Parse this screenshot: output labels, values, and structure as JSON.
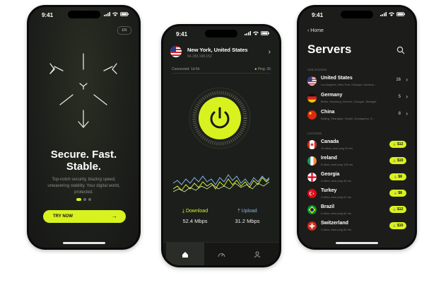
{
  "onboarding": {
    "status_time": "9:41",
    "lang": "EN",
    "headline": [
      "Secure. Fast.",
      "Stable."
    ],
    "description": [
      "Top-notch security, blazing speed,",
      "unwavering stability. Your digital world,",
      "protected."
    ],
    "cta_label": "TRY NOW",
    "cta_arrow": "→"
  },
  "connection": {
    "status_time": "9:41",
    "location_name": "New York, United States",
    "ip": "64.183.168.152",
    "connected_label": "Connected: 1d 6h",
    "ping_label": "Ping:",
    "ping_value": "26",
    "download_label": "Download",
    "download_value": "52.4 Mbps",
    "upload_label": "Upload",
    "upload_value": "31.2 Mbps",
    "tabs": [
      {
        "icon": "home-icon",
        "active": true
      },
      {
        "icon": "speedometer-icon",
        "active": false
      },
      {
        "icon": "profile-icon",
        "active": false
      }
    ]
  },
  "servers": {
    "status_time": "9:41",
    "back_label": "Home",
    "title": "Servers",
    "unlocked_label": "UNLOCKED",
    "locked_label": "LOCKED",
    "unlocked": [
      {
        "name": "United States",
        "cities": "Los Angeles, New York, Chicago, Houston...",
        "count": "16",
        "flag": "us"
      },
      {
        "name": "Germany",
        "cities": "Berlin, Hamburg, Munich, Cologne, Stuttgart",
        "count": "5",
        "flag": "de"
      },
      {
        "name": "China",
        "cities": "Beijing, Shanghai, Tianjin, Guangzhou, S...",
        "count": "8",
        "flag": "cn"
      }
    ],
    "locked": [
      {
        "name": "Canada",
        "cities": "10 cities, best ping 94 ms",
        "price": "$12",
        "flag": "ca"
      },
      {
        "name": "Ireland",
        "cities": "6 cities, best ping 126 ms",
        "price": "$10",
        "flag": "ie"
      },
      {
        "name": "Georgia",
        "cities": "4 cities, best ping 48 ms",
        "price": "$8",
        "flag": "ge"
      },
      {
        "name": "Turkey",
        "cities": "3 cities, best ping 51 ms",
        "price": "$8",
        "flag": "tr"
      },
      {
        "name": "Brazil",
        "cities": "6 cities, best ping 84 ms",
        "price": "$12",
        "flag": "br"
      },
      {
        "name": "Switzerland",
        "cities": "3 cities, best ping 50 ms",
        "price": "$10",
        "flag": "ch"
      }
    ]
  },
  "colors": {
    "accent": "#d8f21f",
    "upload": "#7fb6e6",
    "background": "#1c1e1b"
  }
}
